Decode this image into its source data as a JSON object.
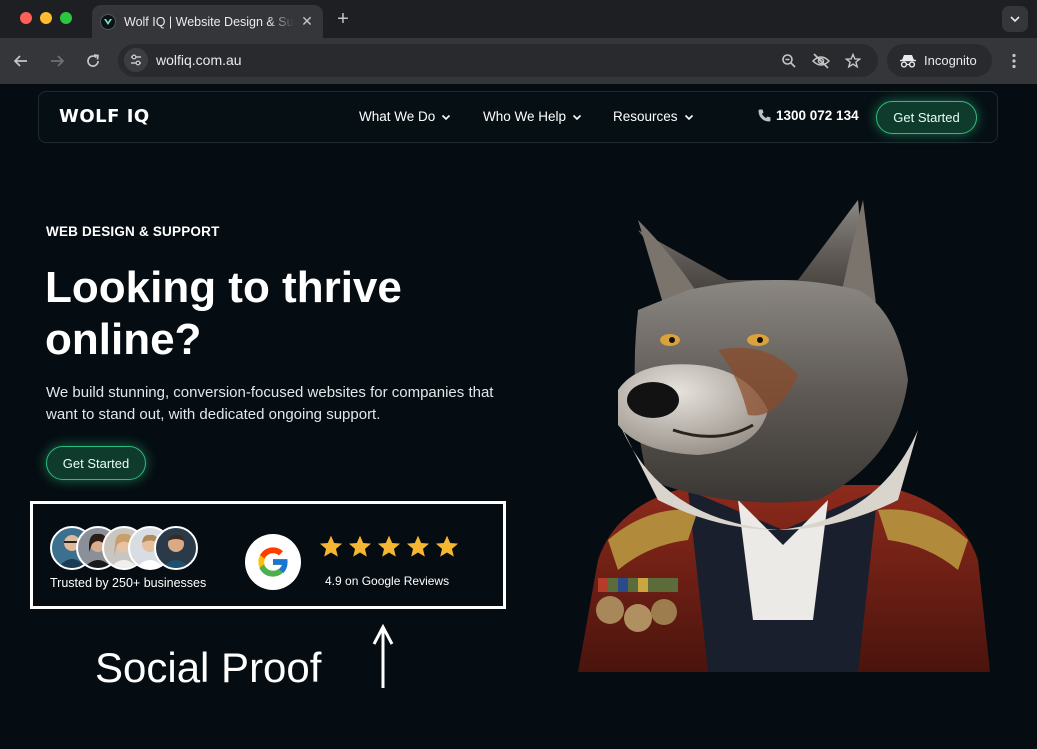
{
  "browser": {
    "tab_title": "Wolf IQ | Website Design & Support",
    "tab_close": "✕",
    "new_tab": "+",
    "url": "wolfiq.com.au",
    "incognito_label": "Incognito"
  },
  "site": {
    "logo": "WOLF IQ",
    "nav": {
      "items": [
        {
          "label": "What We Do",
          "icon": "chevron-down-icon"
        },
        {
          "label": "Who We Help",
          "icon": "chevron-down-icon"
        },
        {
          "label": "Resources",
          "icon": "chevron-down-icon"
        }
      ],
      "phone": "1300 072 134",
      "cta": "Get Started"
    },
    "hero": {
      "eyebrow": "WEB DESIGN & SUPPORT",
      "headline_line1": "Looking to thrive",
      "headline_line2": "online?",
      "subtext": "We build stunning, conversion-focused websites for companies that want to stand out, with dedicated ongoing support.",
      "cta": "Get Started"
    },
    "social_proof": {
      "trusted_text": "Trusted by 250+ businesses",
      "avatar_count": 5,
      "rating_value": 4.9,
      "rating_text": "4.9 on Google Reviews",
      "stars": 5,
      "star_color": "#f5b731"
    },
    "annotation": "Social Proof"
  },
  "colors": {
    "page_bg": "#050d12",
    "accent_green": "#2bbd7e",
    "cta_bg": "#0f3b2c"
  }
}
